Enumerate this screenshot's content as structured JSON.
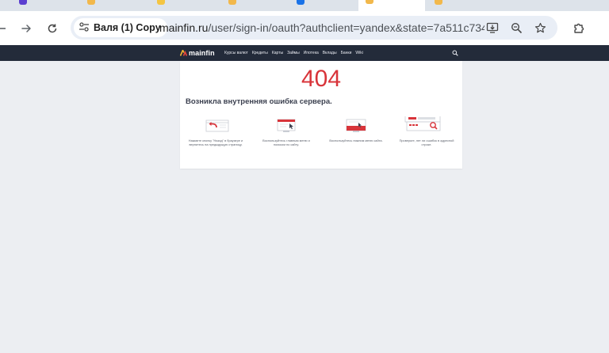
{
  "browser": {
    "profile_chip": {
      "label": "Валя (1) Copy"
    },
    "address": {
      "host": "mainfin.ru",
      "path": "/user/sign-in/oauth?authclient=yandex&state=7a511c734..."
    }
  },
  "site": {
    "logo_text": "mainfin",
    "nav": [
      "Курсы валют",
      "Кредиты",
      "Карты",
      "Займы",
      "Ипотека",
      "Вклады",
      "Банки",
      "Wiki"
    ]
  },
  "error": {
    "code": "404",
    "title": "Возникла внутренняя ошибка сервера.",
    "tips": [
      "Нажмите кнопку \"Назад\" в браузере и вернитесь на предыдущую страницу.",
      "Воспользуйтесь главным меню и поиском по сайту.",
      "Воспользуйтесь нижним меню сайта.",
      "Проверьте, нет ли ошибок в адресной строке."
    ]
  },
  "colors": {
    "accent_red": "#d8343a",
    "header_bg": "#232b3a",
    "page_bg": "#eceef2"
  }
}
